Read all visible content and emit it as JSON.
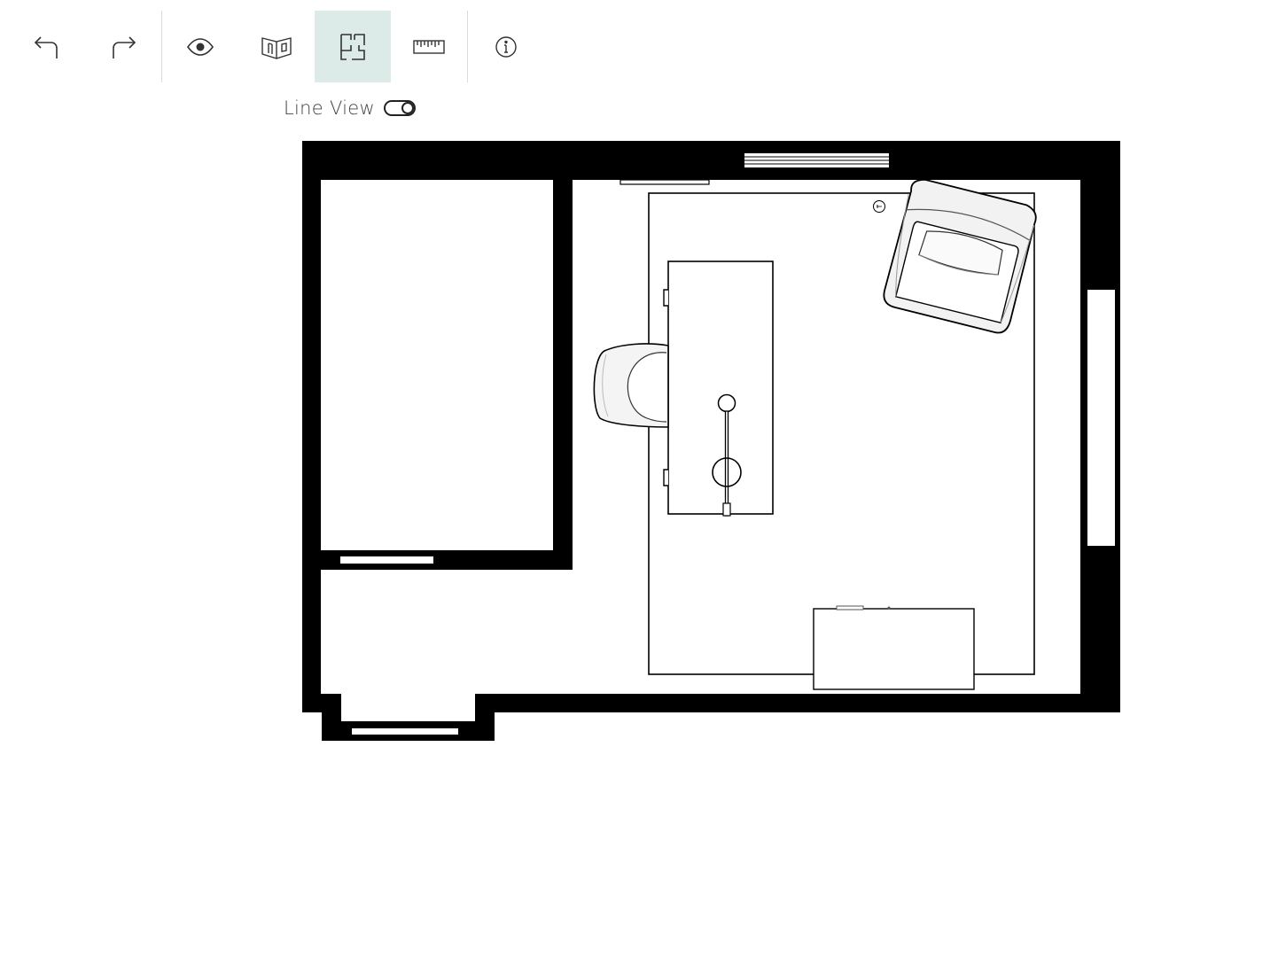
{
  "toolbar": {
    "buttons": [
      {
        "id": "undo",
        "icon": "undo-icon",
        "active": false
      },
      {
        "id": "redo",
        "icon": "redo-icon",
        "active": false
      },
      {
        "id": "view",
        "icon": "eye-icon",
        "active": false
      },
      {
        "id": "3d-view",
        "icon": "walls-3d-icon",
        "active": false
      },
      {
        "id": "floorplan",
        "icon": "floorplan-icon",
        "active": true
      },
      {
        "id": "measure",
        "icon": "ruler-icon",
        "active": false
      },
      {
        "id": "info",
        "icon": "info-icon",
        "active": false
      }
    ]
  },
  "line_view": {
    "label": "Line View",
    "enabled": true
  },
  "colors": {
    "active_tool_bg": "#dcebe8",
    "wall": "#000000",
    "icon": "#333333"
  }
}
